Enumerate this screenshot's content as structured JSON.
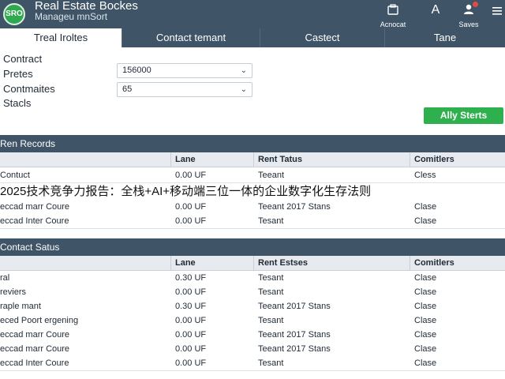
{
  "header": {
    "logo_text": "SRO",
    "title": "Real Estate Bockes",
    "subtitle": "Manageu mnSort",
    "account_label": "Acnocat",
    "a_label": "A",
    "saves_label": "Saves"
  },
  "tabs": [
    {
      "label": "Treal Iroltes",
      "active": true
    },
    {
      "label": "Contact temant",
      "active": false
    },
    {
      "label": "Castect",
      "active": false
    },
    {
      "label": "Tane",
      "active": false
    }
  ],
  "form": {
    "contract_label": "Contract",
    "pretes_label": "Pretes",
    "pretes_value": "156000",
    "contmaites_label": "Contmaites",
    "contmaites_value": "65",
    "stacls_label": "Stacls",
    "apply_label": "Ally Sterts"
  },
  "rent_records": {
    "title": "Ren Records",
    "headers": [
      "",
      "Lane",
      "Rent Tatus",
      "Comitlers"
    ],
    "rows": [
      [
        "Contuct",
        "0.00 UF",
        "Teeant",
        "Cless"
      ],
      [
        "",
        "",
        "",
        ""
      ],
      [
        "eccad marr Coure",
        "0.00 UF",
        "Teeant 2017 Stans",
        "Clase"
      ],
      [
        "eccad Inter Coure",
        "0.00 UF",
        "Tesant",
        "Clase"
      ]
    ]
  },
  "contact_status": {
    "title": "Contact Satus",
    "headers": [
      "",
      "Lane",
      "Rent Estses",
      "Comitlers"
    ],
    "rows": [
      [
        "ral",
        "0.30 UF",
        "Tesant",
        "Clase"
      ],
      [
        "reviers",
        "0.00 UF",
        "Tesant",
        "Clase"
      ],
      [
        "raple mant",
        "0.30 UF",
        "Teeant 2017 Stans",
        "Clase"
      ],
      [
        "eced Poort ergening",
        "0.00 UF",
        "Tesant",
        "Clase"
      ],
      [
        "eccad marr Coure",
        "0.00 UF",
        "Teeant 2017 Stans",
        "Clase"
      ],
      [
        "eccad marr Coure",
        "0.00 UF",
        "Teeant 2017 Stans",
        "Clase"
      ],
      [
        "eccad Inter Coure",
        "0.00 UF",
        "Tesant",
        "Clase"
      ]
    ]
  },
  "overlay_text": "2025技术竞争力报告：全栈+AI+移动端三位一体的企业数字化生存法则",
  "colors": {
    "header_bg": "#3f5466",
    "accent_green": "#2fb04f",
    "table_header_bg": "#e7ebef"
  },
  "icons": {
    "account": "account-icon",
    "saves": "user-icon",
    "menu": "hamburger-menu-icon"
  }
}
